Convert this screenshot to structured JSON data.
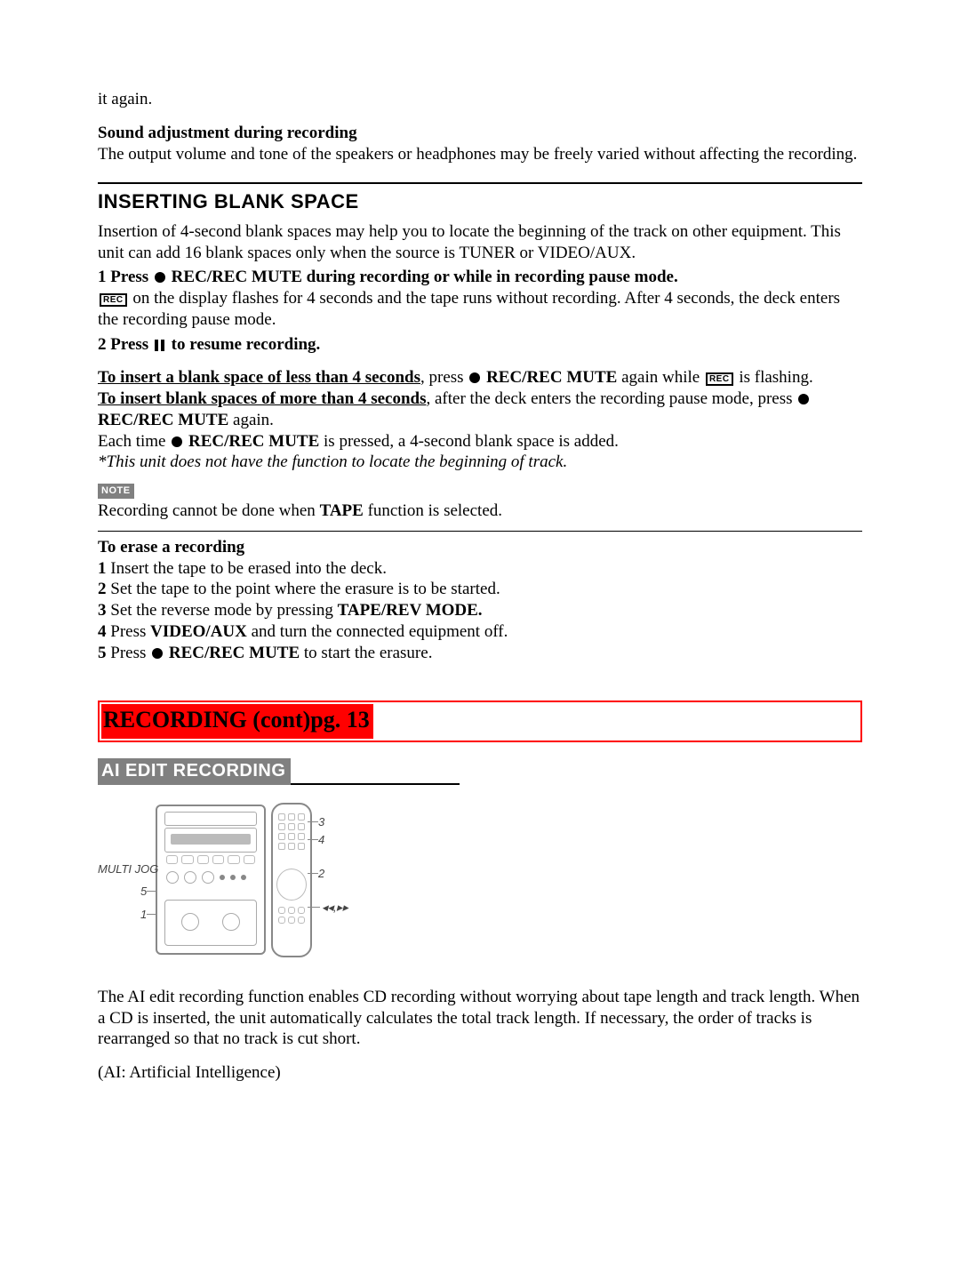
{
  "intro": {
    "again": "it again.",
    "sound_head": "Sound adjustment during recording",
    "sound_body": "The output volume and tone of the speakers or headphones may be freely varied without affecting the recording."
  },
  "blank": {
    "heading": "INSERTING BLANK SPACE",
    "p1": "Insertion of 4-second blank spaces may help you to locate the beginning of the track on other equipment. This unit can add 16 blank spaces only when the source is TUNER or VIDEO/AUX.",
    "s1a": "1 Press ",
    "s1b": " REC/REC MUTE during recording or while in recording pause mode.",
    "s1_rec_glyph": "REC",
    "s1_desc": " on the display flashes for 4 seconds and the tape runs without recording. After 4 seconds, the deck enters the recording pause mode.",
    "s2a": "2 Press ",
    "s2b": " to resume recording.",
    "less_a": "To insert a blank space of less than 4 seconds",
    "less_b": ", press ",
    "less_c": " REC/REC MUTE",
    "less_d": " again while ",
    "less_e": "REC",
    "less_f": " is flashing.",
    "more_a": "To insert blank spaces of more than 4 seconds",
    "more_b": ", after the deck enters the recording pause mode, press ",
    "more_c": "REC/REC MUTE",
    "more_d": " again.",
    "each_a": "Each time ",
    "each_b": " REC/REC MUTE",
    "each_c": " is pressed, a 4-second blank space is added.",
    "star": "*This unit does not have the function to locate the beginning of track.",
    "note_label": "NOTE",
    "note_a": "Recording cannot be done when ",
    "note_b": "TAPE",
    "note_c": " function is selected."
  },
  "erase": {
    "head": "To erase a recording",
    "l1a": "1",
    "l1b": " Insert the tape to be erased into the deck.",
    "l2a": "2",
    "l2b": " Set the tape to the point where the erasure is to be started.",
    "l3a": "3",
    "l3b": " Set the reverse mode by pressing ",
    "l3c": "TAPE/REV MODE.",
    "l4a": "4",
    "l4b": " Press ",
    "l4c": "VIDEO/AUX",
    "l4d": " and turn the connected equipment off.",
    "l5a": "5",
    "l5b": " Press ",
    "l5c": " REC/REC MUTE",
    "l5d": " to start the erasure."
  },
  "redbar": "RECORDING (cont)pg. 13",
  "ai": {
    "heading": "AI EDIT RECORDING",
    "fig": {
      "multi_jog": "MULTI JOG",
      "n1": "1",
      "n2": "2",
      "n3": "3",
      "n4": "4",
      "n5": "5",
      "transport": "◂◂,▸▸"
    },
    "p1": "The AI edit recording function enables CD recording without worrying about tape length and track length. When a CD is inserted, the unit automatically calculates the total track length. If necessary, the order of tracks is rearranged so that no track is cut short.",
    "p2": "(AI: Artificial Intelligence)"
  }
}
